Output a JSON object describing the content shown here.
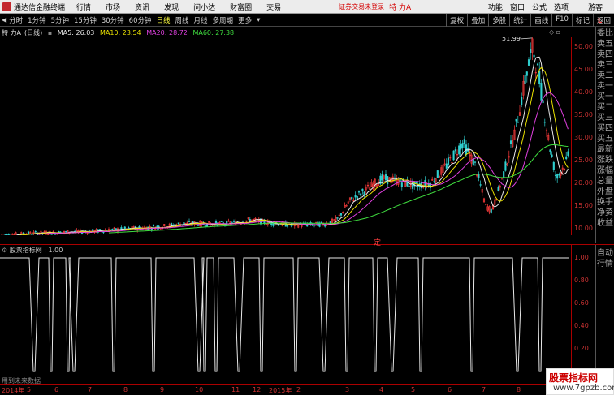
{
  "menubar": {
    "app_title": "通达信金融终端",
    "items": [
      "行情",
      "市场",
      "资讯",
      "发现",
      "问小达",
      "财富圈",
      "交易"
    ],
    "status": "证券交易未登录",
    "stock": "特 力A",
    "right": [
      "功能",
      "窗口",
      "公式",
      "选项"
    ],
    "guest": "游客"
  },
  "periodbar": {
    "periods": [
      "分时",
      "1分钟",
      "5分钟",
      "15分钟",
      "30分钟",
      "60分钟",
      "日线",
      "周线",
      "月线",
      "多周期",
      "更多"
    ],
    "active_index": 6,
    "tools": [
      "复权",
      "叠加",
      "多股",
      "统计",
      "画线",
      "F10",
      "标记",
      "返回"
    ]
  },
  "chart_header": {
    "name": "特 力A",
    "period": "(日线)",
    "ma": [
      {
        "label": "MA5: 26.03",
        "color": "#e8e8e8"
      },
      {
        "label": "MA10: 23.54",
        "color": "#e8e000"
      },
      {
        "label": "MA20: 28.72",
        "color": "#e040e0"
      },
      {
        "label": "MA60: 27.38",
        "color": "#40e040"
      }
    ],
    "top_icons": [
      "◇",
      "◊",
      "▫",
      "✕"
    ]
  },
  "price_axis": {
    "ticks": [
      "50.00",
      "45.00",
      "40.00",
      "35.00",
      "30.00",
      "25.00",
      "20.00",
      "15.00",
      "10.00"
    ],
    "high_label": "51.99",
    "low_label": "6.50"
  },
  "right_panel": {
    "items": [
      "委比",
      "卖五",
      "卖四",
      "卖三",
      "卖二",
      "卖一",
      "买一",
      "买二",
      "买三",
      "买四",
      "买五",
      "最新",
      "涨跌",
      "涨幅",
      "总量",
      "外盘",
      "换手",
      "净资",
      "收益"
    ],
    "bottom": [
      "自动",
      "行情"
    ],
    "badge": "L"
  },
  "indicator": {
    "title": "股票指标网",
    "value": ": 1.00",
    "ticks": [
      "1.00",
      "0.80",
      "0.60",
      "0.40",
      "0.20",
      "0.00"
    ]
  },
  "dates": [
    "2014年",
    "5",
    "6",
    "7",
    "8",
    "9",
    "10",
    "11",
    "12",
    "2015年",
    "2",
    "3",
    "4",
    "5",
    "6",
    "7",
    "8",
    "9"
  ],
  "future_note": "用到未来数据",
  "ding": "定",
  "watermark": {
    "line1": "股票指标网",
    "line2": "www.7gpzb.com"
  },
  "chart_data": {
    "type": "candlestick",
    "series_summary": "daily K-line of 特力A, flat near 8-12 then surging to high 51.99",
    "price_range": [
      6.5,
      52
    ],
    "ma_current": {
      "MA5": 26.03,
      "MA10": 23.54,
      "MA20": 28.72,
      "MA60": 27.38
    },
    "indicator_drops": [
      0.06,
      0.09,
      0.12,
      0.13,
      0.2,
      0.27,
      0.35,
      0.36,
      0.38,
      0.42,
      0.46,
      0.52,
      0.57,
      0.61,
      0.66,
      0.69,
      0.74,
      0.83,
      0.91,
      0.95
    ]
  }
}
